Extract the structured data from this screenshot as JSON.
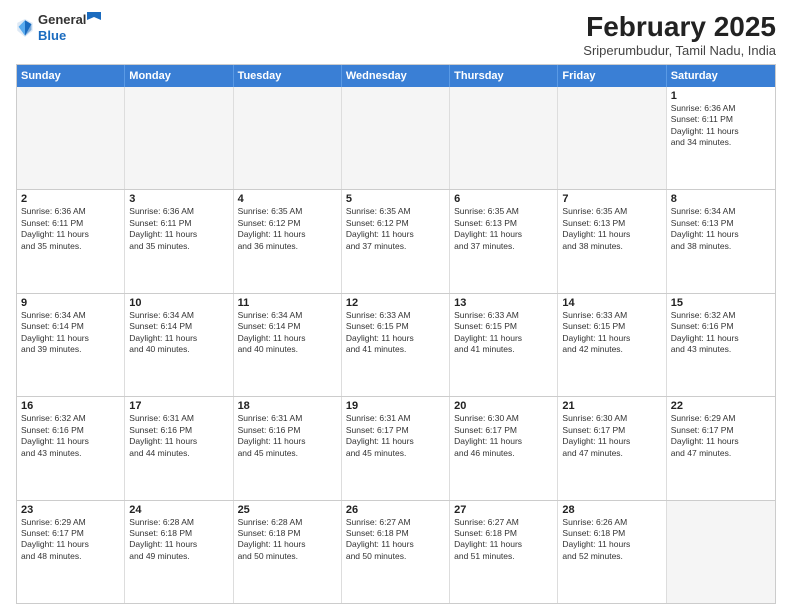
{
  "logo": {
    "general": "General",
    "blue": "Blue"
  },
  "title": "February 2025",
  "subtitle": "Sriperumbudur, Tamil Nadu, India",
  "header": {
    "days": [
      "Sunday",
      "Monday",
      "Tuesday",
      "Wednesday",
      "Thursday",
      "Friday",
      "Saturday"
    ]
  },
  "weeks": [
    [
      {
        "day": "",
        "info": ""
      },
      {
        "day": "",
        "info": ""
      },
      {
        "day": "",
        "info": ""
      },
      {
        "day": "",
        "info": ""
      },
      {
        "day": "",
        "info": ""
      },
      {
        "day": "",
        "info": ""
      },
      {
        "day": "1",
        "info": "Sunrise: 6:36 AM\nSunset: 6:11 PM\nDaylight: 11 hours\nand 34 minutes."
      }
    ],
    [
      {
        "day": "2",
        "info": "Sunrise: 6:36 AM\nSunset: 6:11 PM\nDaylight: 11 hours\nand 35 minutes."
      },
      {
        "day": "3",
        "info": "Sunrise: 6:36 AM\nSunset: 6:11 PM\nDaylight: 11 hours\nand 35 minutes."
      },
      {
        "day": "4",
        "info": "Sunrise: 6:35 AM\nSunset: 6:12 PM\nDaylight: 11 hours\nand 36 minutes."
      },
      {
        "day": "5",
        "info": "Sunrise: 6:35 AM\nSunset: 6:12 PM\nDaylight: 11 hours\nand 37 minutes."
      },
      {
        "day": "6",
        "info": "Sunrise: 6:35 AM\nSunset: 6:13 PM\nDaylight: 11 hours\nand 37 minutes."
      },
      {
        "day": "7",
        "info": "Sunrise: 6:35 AM\nSunset: 6:13 PM\nDaylight: 11 hours\nand 38 minutes."
      },
      {
        "day": "8",
        "info": "Sunrise: 6:34 AM\nSunset: 6:13 PM\nDaylight: 11 hours\nand 38 minutes."
      }
    ],
    [
      {
        "day": "9",
        "info": "Sunrise: 6:34 AM\nSunset: 6:14 PM\nDaylight: 11 hours\nand 39 minutes."
      },
      {
        "day": "10",
        "info": "Sunrise: 6:34 AM\nSunset: 6:14 PM\nDaylight: 11 hours\nand 40 minutes."
      },
      {
        "day": "11",
        "info": "Sunrise: 6:34 AM\nSunset: 6:14 PM\nDaylight: 11 hours\nand 40 minutes."
      },
      {
        "day": "12",
        "info": "Sunrise: 6:33 AM\nSunset: 6:15 PM\nDaylight: 11 hours\nand 41 minutes."
      },
      {
        "day": "13",
        "info": "Sunrise: 6:33 AM\nSunset: 6:15 PM\nDaylight: 11 hours\nand 41 minutes."
      },
      {
        "day": "14",
        "info": "Sunrise: 6:33 AM\nSunset: 6:15 PM\nDaylight: 11 hours\nand 42 minutes."
      },
      {
        "day": "15",
        "info": "Sunrise: 6:32 AM\nSunset: 6:16 PM\nDaylight: 11 hours\nand 43 minutes."
      }
    ],
    [
      {
        "day": "16",
        "info": "Sunrise: 6:32 AM\nSunset: 6:16 PM\nDaylight: 11 hours\nand 43 minutes."
      },
      {
        "day": "17",
        "info": "Sunrise: 6:31 AM\nSunset: 6:16 PM\nDaylight: 11 hours\nand 44 minutes."
      },
      {
        "day": "18",
        "info": "Sunrise: 6:31 AM\nSunset: 6:16 PM\nDaylight: 11 hours\nand 45 minutes."
      },
      {
        "day": "19",
        "info": "Sunrise: 6:31 AM\nSunset: 6:17 PM\nDaylight: 11 hours\nand 45 minutes."
      },
      {
        "day": "20",
        "info": "Sunrise: 6:30 AM\nSunset: 6:17 PM\nDaylight: 11 hours\nand 46 minutes."
      },
      {
        "day": "21",
        "info": "Sunrise: 6:30 AM\nSunset: 6:17 PM\nDaylight: 11 hours\nand 47 minutes."
      },
      {
        "day": "22",
        "info": "Sunrise: 6:29 AM\nSunset: 6:17 PM\nDaylight: 11 hours\nand 47 minutes."
      }
    ],
    [
      {
        "day": "23",
        "info": "Sunrise: 6:29 AM\nSunset: 6:17 PM\nDaylight: 11 hours\nand 48 minutes."
      },
      {
        "day": "24",
        "info": "Sunrise: 6:28 AM\nSunset: 6:18 PM\nDaylight: 11 hours\nand 49 minutes."
      },
      {
        "day": "25",
        "info": "Sunrise: 6:28 AM\nSunset: 6:18 PM\nDaylight: 11 hours\nand 50 minutes."
      },
      {
        "day": "26",
        "info": "Sunrise: 6:27 AM\nSunset: 6:18 PM\nDaylight: 11 hours\nand 50 minutes."
      },
      {
        "day": "27",
        "info": "Sunrise: 6:27 AM\nSunset: 6:18 PM\nDaylight: 11 hours\nand 51 minutes."
      },
      {
        "day": "28",
        "info": "Sunrise: 6:26 AM\nSunset: 6:18 PM\nDaylight: 11 hours\nand 52 minutes."
      },
      {
        "day": "",
        "info": ""
      }
    ]
  ]
}
